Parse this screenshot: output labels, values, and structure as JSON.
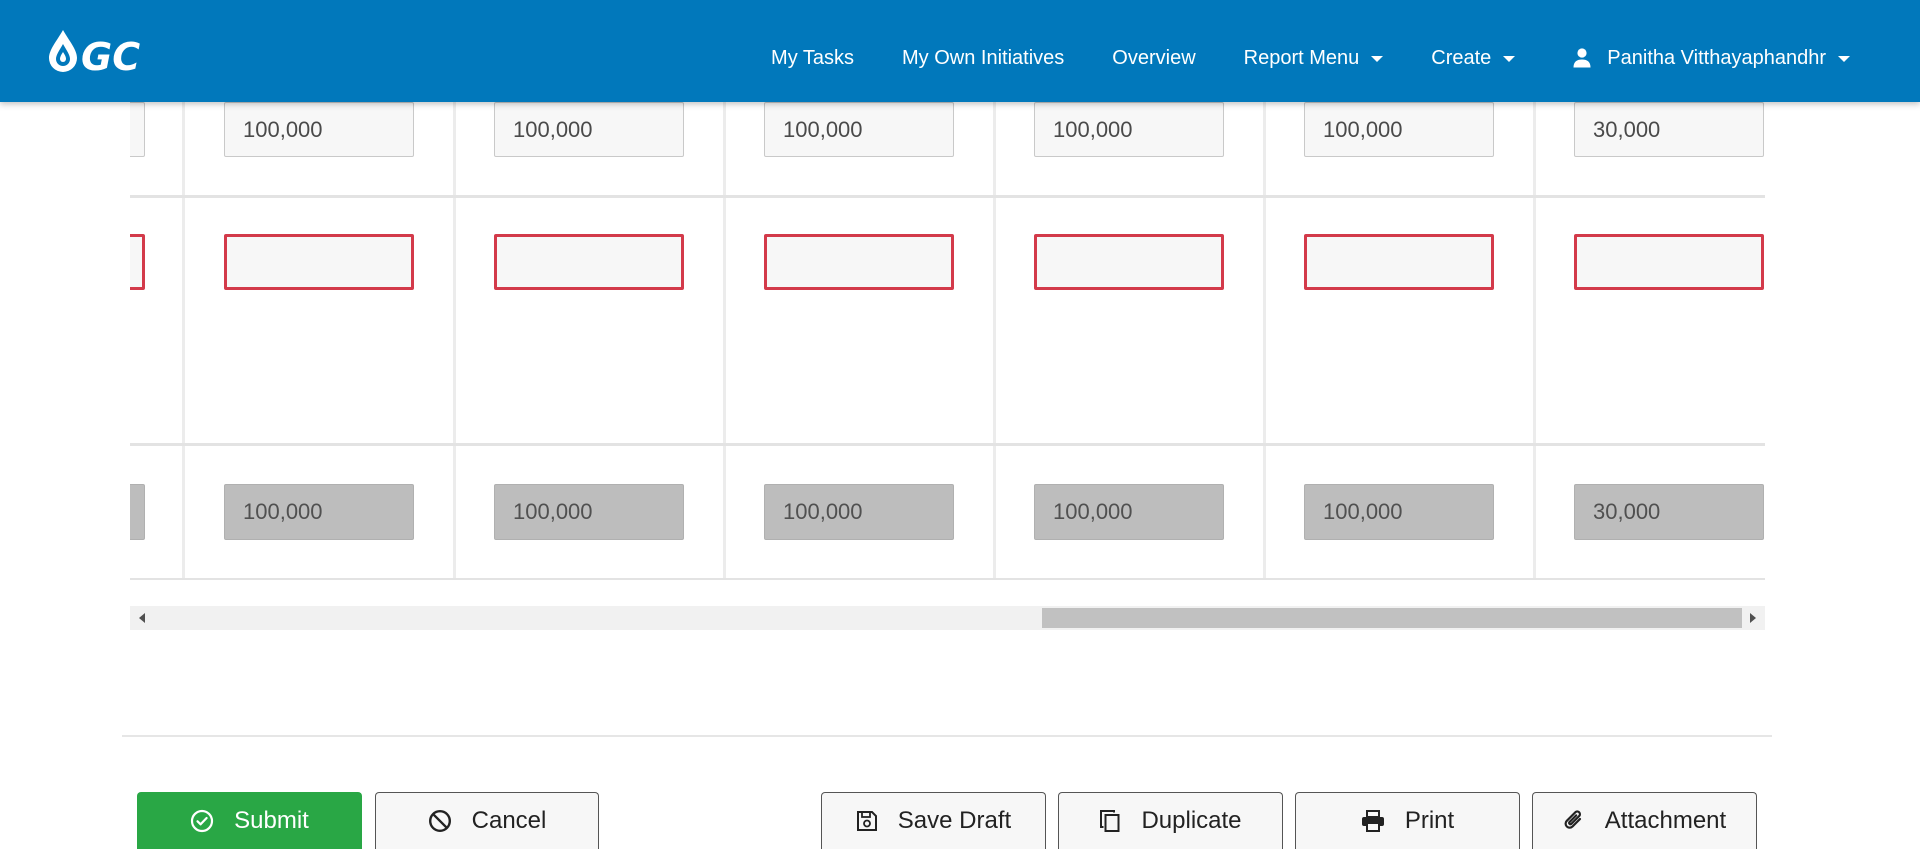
{
  "header": {
    "logo_text": "GC",
    "nav": {
      "my_tasks": "My Tasks",
      "my_own_initiatives": "My Own Initiatives",
      "overview": "Overview",
      "report_menu": "Report Menu",
      "create": "Create",
      "user_name": "Panitha Vitthayaphandhr"
    }
  },
  "table": {
    "row1_values": [
      "100,000",
      "100,000",
      "100,000",
      "100,000",
      "100,000",
      "30,000"
    ],
    "row2_values": [
      "",
      "",
      "",
      "",
      "",
      ""
    ],
    "row3_values": [
      "100,000",
      "100,000",
      "100,000",
      "100,000",
      "100,000",
      "30,000"
    ]
  },
  "scrollbar": {
    "horizontal_position": 0.62
  },
  "buttons": {
    "submit": "Submit",
    "cancel": "Cancel",
    "save_draft": "Save Draft",
    "duplicate": "Duplicate",
    "print": "Print",
    "attachment": "Attachment"
  },
  "colors": {
    "header_bg": "#0178bb",
    "submit_bg": "#29a745",
    "error_border": "#d33a4a",
    "disabled_input": "#bdbdbd"
  },
  "icons": [
    "gc-logo",
    "caret-down-icon",
    "user-icon",
    "check-circle-icon",
    "ban-icon",
    "save-icon",
    "copy-icon",
    "print-icon",
    "paperclip-icon"
  ]
}
